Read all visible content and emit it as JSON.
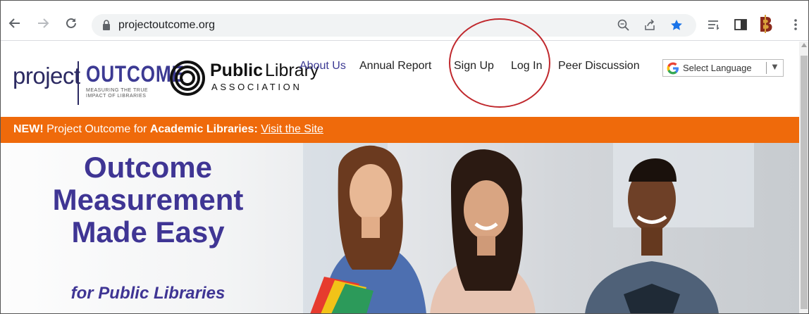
{
  "browser": {
    "url": "projectoutcome.org",
    "icons": [
      "back-arrow-icon",
      "forward-arrow-icon",
      "reload-icon",
      "lock-icon",
      "zoom-icon",
      "share-icon",
      "bookmark-star-icon",
      "reading-list-icon",
      "side-panel-icon",
      "extension-icon",
      "menu-icon"
    ],
    "accent": "#1a73e8"
  },
  "header": {
    "logo": {
      "project": "project",
      "outcome": "OUTCOME",
      "tagline_1": "MEASURING THE TRUE",
      "tagline_2": "IMPACT OF LIBRARIES",
      "pla_public": "Public",
      "pla_library": "Library",
      "pla_association": "ASSOCIATION"
    },
    "nav": {
      "about": "About Us",
      "annual_report": "Annual Report",
      "sign_up": "Sign Up",
      "log_in": "Log In",
      "peer_discussion": "Peer Discussion"
    },
    "language": {
      "label": "Select Language",
      "arrow": "▼"
    }
  },
  "banner": {
    "new": "NEW!",
    "text": " Project Outcome for ",
    "academic": "Academic Libraries:",
    "link": "Visit the Site",
    "color": "#ef6a0b"
  },
  "hero": {
    "headline_1": "Outcome",
    "headline_2": "Measurement",
    "headline_3": "Made Easy",
    "subhead": "for Public Libraries",
    "color": "#3f3594"
  },
  "annotation": {
    "circle_color": "#c0282d"
  }
}
